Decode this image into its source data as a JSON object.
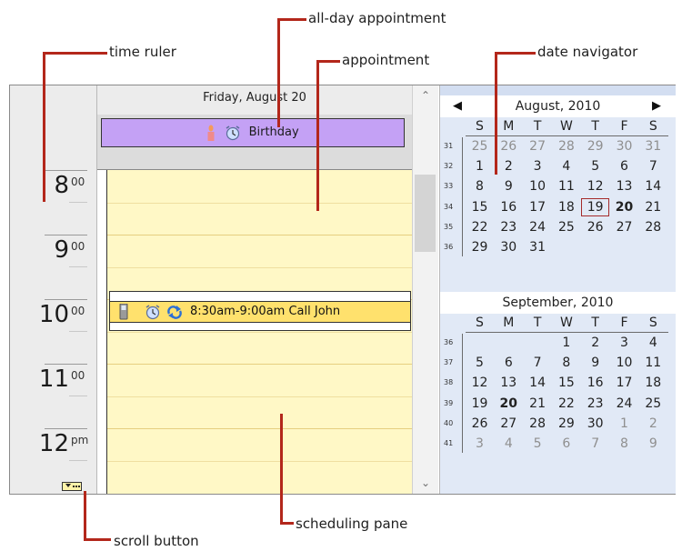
{
  "annotations": {
    "allday": "all-day  appointment",
    "ruler": "time ruler",
    "appointment": "appointment",
    "navigator": "date navigator",
    "scroll": "scroll button",
    "pane": "scheduling pane"
  },
  "day_header": "Friday, August 20",
  "allday_appt": {
    "text": "Birthday"
  },
  "appointment": {
    "text": "8:30am-9:00am Call John"
  },
  "hours": [
    {
      "big": "8",
      "small": "00"
    },
    {
      "big": "9",
      "small": "00"
    },
    {
      "big": "10",
      "small": "00"
    },
    {
      "big": "11",
      "small": "00"
    },
    {
      "big": "12",
      "small": "pm"
    }
  ],
  "navigator": {
    "dow": [
      "S",
      "M",
      "T",
      "W",
      "T",
      "F",
      "S"
    ],
    "months": [
      {
        "title": "August, 2010",
        "weeks": [
          {
            "wk": "31",
            "days": [
              "25",
              "26",
              "27",
              "28",
              "29",
              "30",
              "31"
            ],
            "dim": [
              0,
              1,
              2,
              3,
              4,
              5,
              6
            ]
          },
          {
            "wk": "32",
            "days": [
              "1",
              "2",
              "3",
              "4",
              "5",
              "6",
              "7"
            ],
            "dim": []
          },
          {
            "wk": "33",
            "days": [
              "8",
              "9",
              "10",
              "11",
              "12",
              "13",
              "14"
            ],
            "dim": []
          },
          {
            "wk": "34",
            "days": [
              "15",
              "16",
              "17",
              "18",
              "19",
              "20",
              "21"
            ],
            "dim": []
          },
          {
            "wk": "35",
            "days": [
              "22",
              "23",
              "24",
              "25",
              "26",
              "27",
              "28"
            ],
            "dim": []
          },
          {
            "wk": "36",
            "days": [
              "29",
              "30",
              "31",
              "",
              "",
              "",
              ""
            ],
            "dim": []
          }
        ]
      },
      {
        "title": "September, 2010",
        "weeks": [
          {
            "wk": "36",
            "days": [
              "",
              "",
              "",
              "1",
              "2",
              "3",
              "4"
            ],
            "dim": []
          },
          {
            "wk": "37",
            "days": [
              "5",
              "6",
              "7",
              "8",
              "9",
              "10",
              "11"
            ],
            "dim": []
          },
          {
            "wk": "38",
            "days": [
              "12",
              "13",
              "14",
              "15",
              "16",
              "17",
              "18"
            ],
            "dim": []
          },
          {
            "wk": "39",
            "days": [
              "19",
              "20",
              "21",
              "22",
              "23",
              "24",
              "25"
            ],
            "dim": []
          },
          {
            "wk": "40",
            "days": [
              "26",
              "27",
              "28",
              "29",
              "30",
              "1",
              "2"
            ],
            "dim": [
              5,
              6
            ]
          },
          {
            "wk": "41",
            "days": [
              "3",
              "4",
              "5",
              "6",
              "7",
              "8",
              "9"
            ],
            "dim": [
              0,
              1,
              2,
              3,
              4,
              5,
              6
            ]
          }
        ]
      }
    ],
    "selected": {
      "month": 0,
      "week": 3,
      "day": 4
    },
    "today": [
      {
        "month": 0,
        "week": 3,
        "day": 5
      },
      {
        "month": 1,
        "week": 3,
        "day": 1
      }
    ]
  }
}
